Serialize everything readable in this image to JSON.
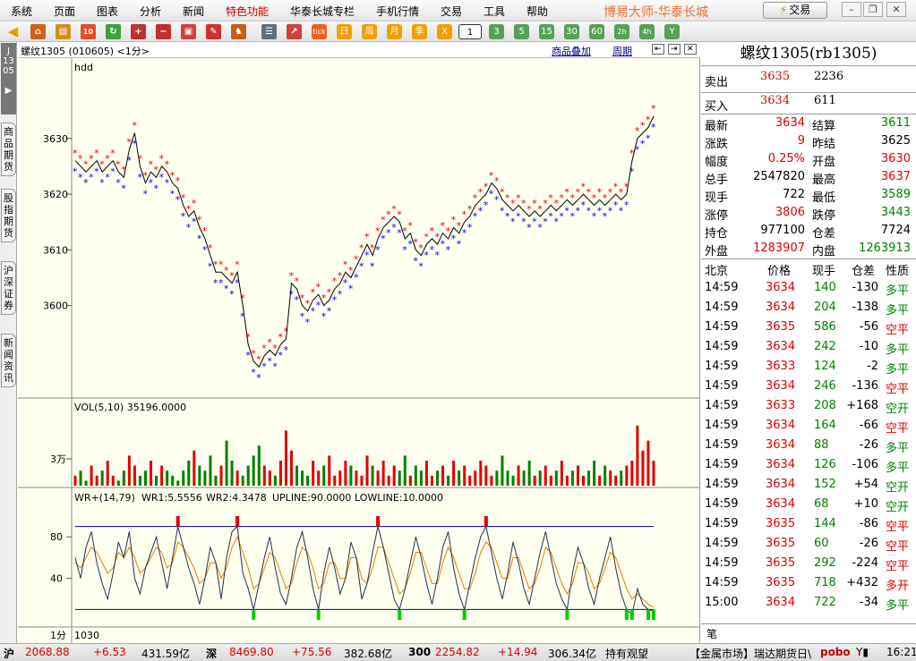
{
  "menu": [
    "系统",
    "页面",
    "图表",
    "分析",
    "新闻",
    "特色功能",
    "华泰长城专栏",
    "手机行情",
    "交易",
    "工具",
    "帮助"
  ],
  "brand": "博易大师-华泰长城",
  "trade_button": "交易",
  "toolbar_periods": [
    "1",
    "3",
    "5",
    "15",
    "30",
    "60",
    "2h",
    "4h",
    "Y"
  ],
  "toolbar_cn": [
    "tick",
    "日",
    "周",
    "月",
    "季",
    "X"
  ],
  "left_tabs": [
    "商品期货",
    "股指期货",
    "沪深证券",
    "新闻资讯"
  ],
  "code_tab": "J135",
  "chart": {
    "header": "螺纹1305 (010605) <1分>",
    "overlay_link": "商品叠加",
    "period_link": "周期",
    "main_label": "hdd",
    "vol_label": "VOL(5,10) 35196.0000",
    "wr_label_a": "WR+(14,79)",
    "wr_label_b": "WR1:5.5556",
    "wr_label_c": "WR2:4.3478",
    "wr_label_d": "UPLINE:90.0000",
    "wr_label_e": "LOWLINE:10.0000",
    "bottom_left": "1分",
    "bottom_time": "1030"
  },
  "chart_data": {
    "type": "line",
    "title": "螺纹1305",
    "price_axis": [
      3630,
      3620,
      3610,
      3600
    ],
    "vol_axis": [
      "3万"
    ],
    "wr_axis": [
      80,
      40
    ],
    "price_series": [
      3626,
      3625,
      3624,
      3625,
      3626,
      3624,
      3625,
      3626,
      3624,
      3623,
      3628,
      3631,
      3625,
      3622,
      3624,
      3623,
      3625,
      3624,
      3622,
      3621,
      3618,
      3616,
      3617,
      3614,
      3612,
      3609,
      3606,
      3606,
      3605,
      3604,
      3606,
      3600,
      3593,
      3590,
      3589,
      3591,
      3592,
      3591,
      3593,
      3594,
      3604,
      3603,
      3600,
      3599,
      3601,
      3602,
      3600,
      3601,
      3603,
      3604,
      3606,
      3605,
      3607,
      3609,
      3611,
      3609,
      3612,
      3614,
      3615,
      3616,
      3615,
      3612,
      3613,
      3610,
      3609,
      3611,
      3612,
      3611,
      3613,
      3612,
      3614,
      3613,
      3615,
      3616,
      3618,
      3619,
      3620,
      3622,
      3621,
      3619,
      3618,
      3617,
      3618,
      3617,
      3616,
      3617,
      3616,
      3617,
      3618,
      3617,
      3618,
      3619,
      3618,
      3619,
      3620,
      3619,
      3618,
      3619,
      3618,
      3619,
      3620,
      3619,
      3620,
      3626,
      3630,
      3631,
      3632,
      3634
    ],
    "volume_series": [
      2,
      3,
      1,
      4,
      2,
      3,
      5,
      2,
      1,
      3,
      6,
      4,
      2,
      3,
      5,
      2,
      4,
      3,
      2,
      1,
      3,
      5,
      7,
      4,
      3,
      6,
      2,
      4,
      9,
      5,
      3,
      2,
      4,
      6,
      8,
      4,
      3,
      2,
      5,
      11,
      7,
      4,
      3,
      2,
      5,
      3,
      4,
      6,
      2,
      3,
      5,
      4,
      3,
      2,
      6,
      4,
      3,
      5,
      2,
      4,
      3,
      6,
      2,
      4,
      3,
      5,
      2,
      3,
      4,
      2,
      5,
      3,
      4,
      2,
      3,
      5,
      4,
      2,
      3,
      6,
      3,
      2,
      4,
      3,
      5,
      2,
      3,
      4,
      2,
      3,
      5,
      2,
      3,
      4,
      2,
      3,
      5,
      2,
      4,
      3,
      2,
      3,
      4,
      5,
      12,
      7,
      9,
      5
    ],
    "wr1_series": [
      60,
      40,
      70,
      85,
      55,
      35,
      20,
      45,
      75,
      60,
      85,
      40,
      25,
      50,
      65,
      80,
      55,
      30,
      60,
      90,
      70,
      50,
      35,
      15,
      40,
      70,
      55,
      20,
      60,
      85,
      90,
      45,
      30,
      10,
      35,
      60,
      80,
      50,
      25,
      15,
      40,
      70,
      85,
      60,
      30,
      10,
      45,
      70,
      50,
      25,
      40,
      75,
      60,
      20,
      35,
      65,
      90,
      70,
      45,
      20,
      10,
      30,
      55,
      80,
      60,
      35,
      15,
      40,
      70,
      85,
      50,
      25,
      10,
      35,
      60,
      80,
      90,
      65,
      40,
      20,
      45,
      75,
      55,
      30,
      15,
      40,
      65,
      85,
      60,
      35,
      20,
      10,
      45,
      70,
      55,
      30,
      15,
      40,
      60,
      80,
      50,
      25,
      10,
      5,
      30,
      15,
      10,
      8
    ],
    "wr2_series": [
      55,
      50,
      60,
      70,
      65,
      55,
      45,
      50,
      65,
      60,
      70,
      60,
      45,
      50,
      60,
      70,
      65,
      50,
      55,
      75,
      70,
      60,
      50,
      35,
      40,
      55,
      55,
      40,
      50,
      70,
      80,
      65,
      50,
      30,
      35,
      50,
      65,
      60,
      45,
      30,
      35,
      55,
      70,
      65,
      50,
      30,
      35,
      55,
      55,
      40,
      40,
      60,
      60,
      40,
      35,
      50,
      70,
      70,
      55,
      40,
      25,
      30,
      45,
      65,
      65,
      50,
      35,
      35,
      55,
      70,
      60,
      45,
      30,
      30,
      45,
      65,
      75,
      70,
      55,
      40,
      40,
      60,
      60,
      45,
      30,
      35,
      50,
      70,
      65,
      50,
      35,
      25,
      35,
      55,
      55,
      45,
      30,
      35,
      50,
      65,
      60,
      45,
      30,
      20,
      25,
      20,
      15,
      12
    ],
    "upline": 90,
    "lowline": 10
  },
  "quote": {
    "title": "螺纹1305(rb1305)",
    "sell_label": "卖出",
    "sell_price": "3635",
    "sell_vol": "2236",
    "buy_label": "买入",
    "buy_price": "3634",
    "buy_vol": "611",
    "stats": [
      {
        "l": "最新",
        "v": "3634",
        "vc": "red",
        "l2": "结算",
        "v2": "3611",
        "v2c": "green"
      },
      {
        "l": "涨跌",
        "v": "9",
        "vc": "red",
        "l2": "昨结",
        "v2": "3625",
        "v2c": "blk"
      },
      {
        "l": "幅度",
        "v": "0.25%",
        "vc": "red",
        "l2": "开盘",
        "v2": "3630",
        "v2c": "red"
      },
      {
        "l": "总手",
        "v": "2547820",
        "vc": "blk",
        "l2": "最高",
        "v2": "3637",
        "v2c": "red"
      },
      {
        "l": "现手",
        "v": "722",
        "vc": "blk",
        "l2": "最低",
        "v2": "3589",
        "v2c": "green"
      },
      {
        "l": "涨停",
        "v": "3806",
        "vc": "red",
        "l2": "跌停",
        "v2": "3443",
        "v2c": "green"
      },
      {
        "l": "持仓",
        "v": "977100",
        "vc": "blk",
        "l2": "仓差",
        "v2": "7724",
        "v2c": "blk"
      },
      {
        "l": "外盘",
        "v": "1283907",
        "vc": "red",
        "l2": "内盘",
        "v2": "1263913",
        "v2c": "green"
      }
    ],
    "tick_header": [
      "北京",
      "价格",
      "现手",
      "仓差",
      "性质"
    ],
    "ticks": [
      [
        "14:59",
        "3634",
        "140",
        "-130",
        "多平",
        "red",
        "green"
      ],
      [
        "14:59",
        "3634",
        "204",
        "-138",
        "多平",
        "red",
        "green"
      ],
      [
        "14:59",
        "3635",
        "586",
        "-56",
        "空平",
        "red",
        "red"
      ],
      [
        "14:59",
        "3634",
        "242",
        "-10",
        "多平",
        "red",
        "green"
      ],
      [
        "14:59",
        "3633",
        "124",
        "-2",
        "多平",
        "red",
        "green"
      ],
      [
        "14:59",
        "3634",
        "246",
        "-136",
        "空平",
        "red",
        "red"
      ],
      [
        "14:59",
        "3633",
        "208",
        "+168",
        "空开",
        "red",
        "green"
      ],
      [
        "14:59",
        "3634",
        "164",
        "-66",
        "空平",
        "red",
        "red"
      ],
      [
        "14:59",
        "3634",
        "88",
        "-26",
        "多平",
        "red",
        "green"
      ],
      [
        "14:59",
        "3634",
        "126",
        "-106",
        "多平",
        "red",
        "green"
      ],
      [
        "14:59",
        "3634",
        "152",
        "+54",
        "空开",
        "red",
        "green"
      ],
      [
        "14:59",
        "3634",
        "68",
        "+10",
        "空开",
        "red",
        "green"
      ],
      [
        "14:59",
        "3635",
        "144",
        "-86",
        "空平",
        "red",
        "red"
      ],
      [
        "14:59",
        "3635",
        "60",
        "-26",
        "空平",
        "red",
        "red"
      ],
      [
        "14:59",
        "3635",
        "292",
        "-224",
        "空平",
        "red",
        "red"
      ],
      [
        "14:59",
        "3635",
        "718",
        "+432",
        "多开",
        "red",
        "red"
      ],
      [
        "15:00",
        "3634",
        "722",
        "-34",
        "多平",
        "red",
        "green"
      ]
    ],
    "footer_tab": "笔"
  },
  "status": {
    "sh_label": "沪",
    "sh_val": "2068.88",
    "sh_chg": "+6.53",
    "sh_amt": "431.59亿",
    "sz_label": "深",
    "sz_val": "8469.80",
    "sz_chg": "+75.56",
    "sz_amt": "382.68亿",
    "i300_label": "300",
    "i300_val": "2254.82",
    "i300_chg": "+14.94",
    "i300_amt": "306.34亿",
    "stance": "持有观望",
    "market": "【金属市场】瑞达期货日\\",
    "logo": "pobo",
    "clock": "16:21"
  }
}
